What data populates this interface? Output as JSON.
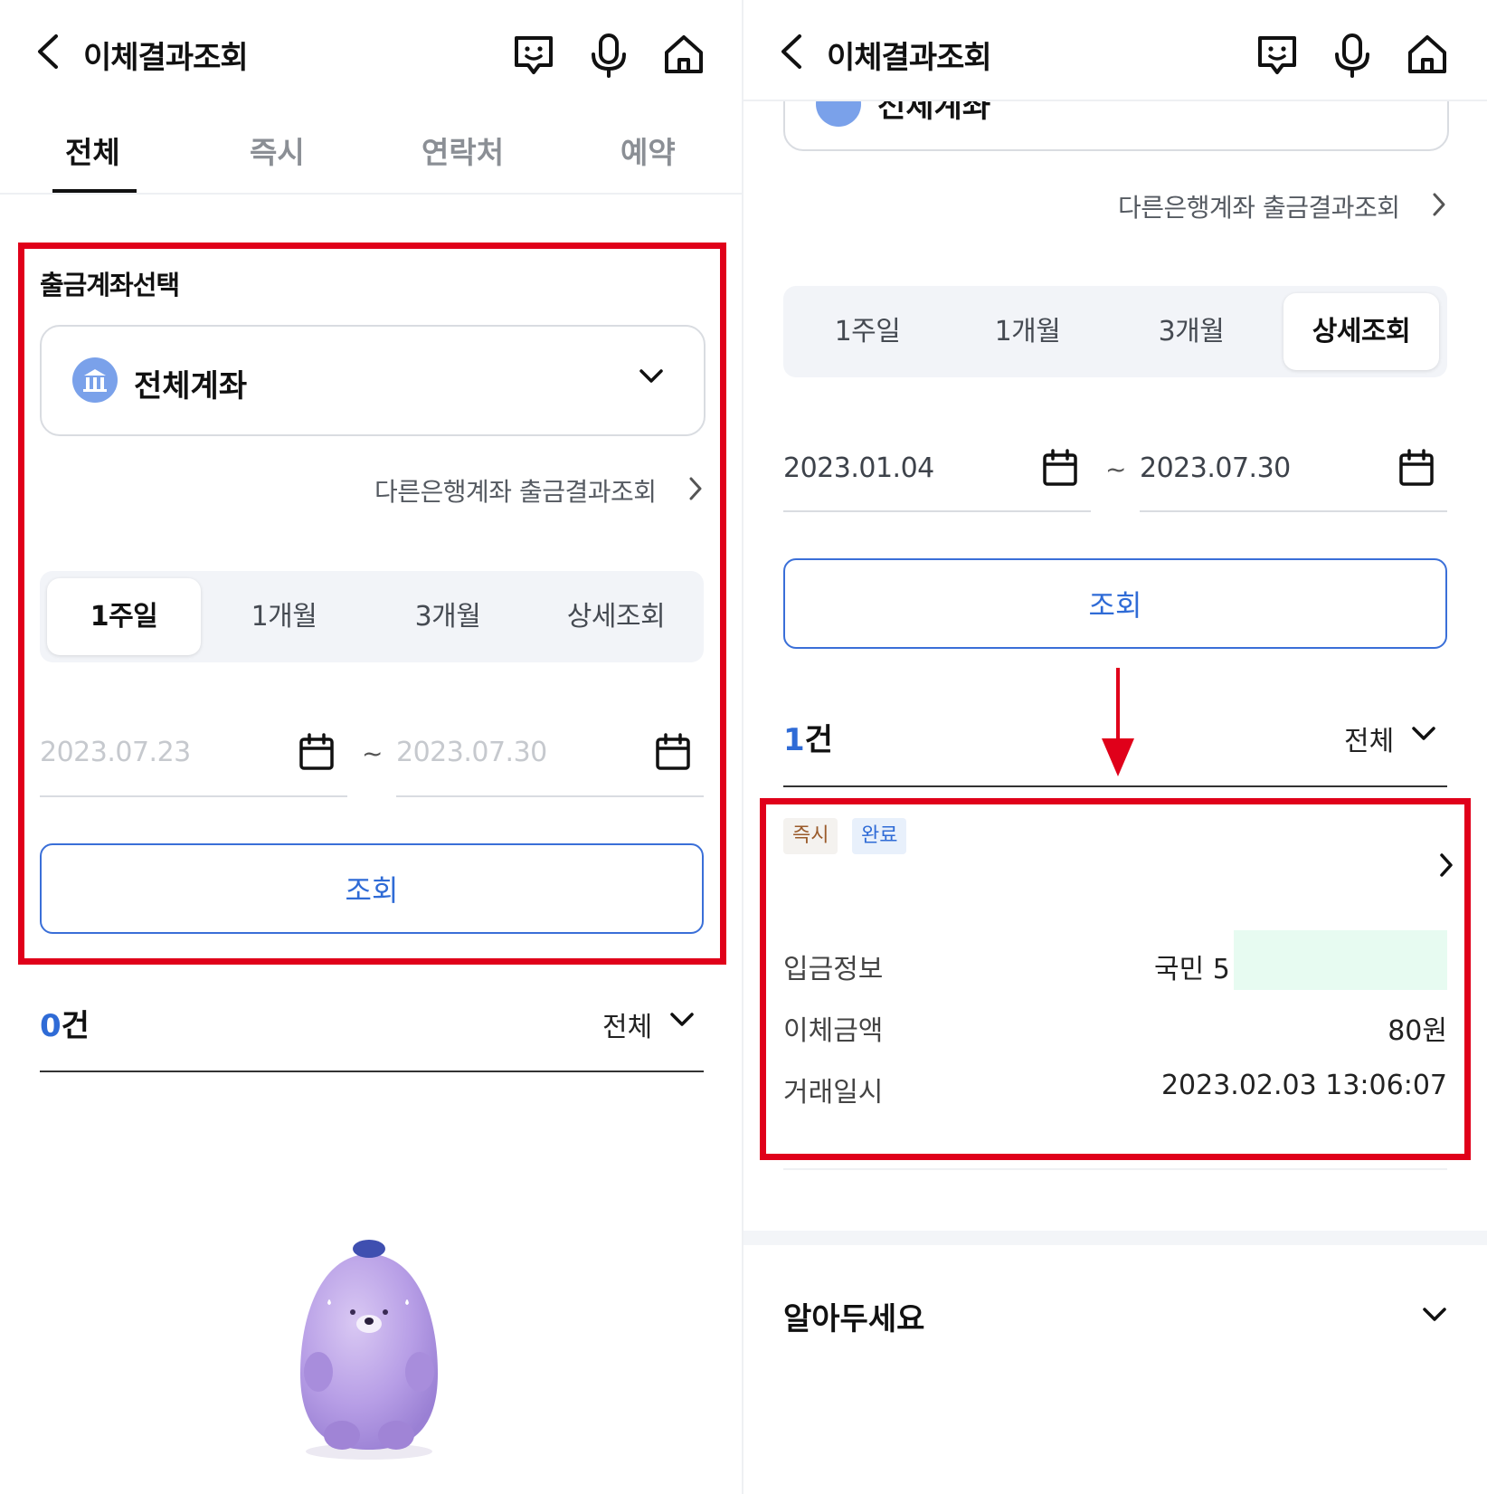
{
  "header": {
    "title": "이체결과조회"
  },
  "tabs": [
    {
      "label": "전체",
      "active": true
    },
    {
      "label": "즉시",
      "active": false
    },
    {
      "label": "연락처",
      "active": false
    },
    {
      "label": "예약",
      "active": false
    }
  ],
  "left": {
    "section_label": "출금계좌선택",
    "account_name": "전체계좌",
    "other_bank_link": "다른은행계좌 출금결과조회",
    "periods": [
      "1주일",
      "1개월",
      "3개월",
      "상세조회"
    ],
    "selected_period": "1주일",
    "date_from": "2023.07.23",
    "date_to": "2023.07.30",
    "tilde": "~",
    "search_button": "조회",
    "count_number": "0",
    "count_unit": "건",
    "filter_label": "전체"
  },
  "right": {
    "partial_account_name": "전체계좌",
    "other_bank_link": "다른은행계좌 출금결과조회",
    "periods": [
      "1주일",
      "1개월",
      "3개월",
      "상세조회"
    ],
    "selected_period": "상세조회",
    "date_from": "2023.01.04",
    "date_to": "2023.07.30",
    "tilde": "~",
    "search_button": "조회",
    "count_number": "1",
    "count_unit": "건",
    "filter_label": "전체",
    "result": {
      "tags": [
        "즉시",
        "완료"
      ],
      "rows": [
        {
          "label": "입금정보",
          "value": "국민 5"
        },
        {
          "label": "이체금액",
          "value": "80원"
        },
        {
          "label": "거래일시",
          "value": "2023.02.03 13:06:07"
        }
      ]
    },
    "notice_title": "알아두세요"
  },
  "colors": {
    "accent_blue": "#2f6bd6",
    "highlight_red": "#e0001a"
  },
  "icons": [
    "back-arrow-icon",
    "chatbot-icon",
    "microphone-icon",
    "home-icon",
    "bank-icon",
    "chevron-down-icon",
    "chevron-right-icon",
    "calendar-icon",
    "red-down-arrow-icon"
  ]
}
